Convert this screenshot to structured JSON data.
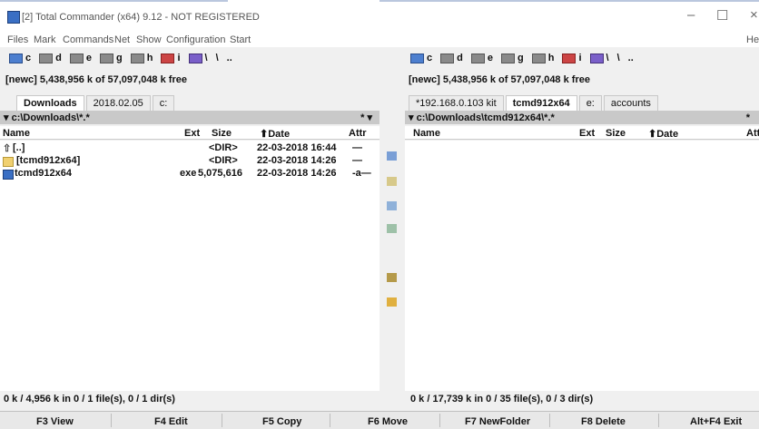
{
  "window": {
    "title": "[2] Total Commander (x64) 9.12 - NOT REGISTERED",
    "minimize": "–",
    "maximize": "☐",
    "close": "×"
  },
  "menu": [
    "Files",
    "Mark",
    "Commands",
    "Net",
    "Show",
    "Configuration",
    "Start"
  ],
  "menu_right": "He",
  "drives": [
    {
      "letter": "c",
      "selected": true
    },
    {
      "letter": "d",
      "selected": false
    },
    {
      "letter": "e",
      "selected": false
    },
    {
      "letter": "g",
      "selected": false
    },
    {
      "letter": "h",
      "selected": false
    },
    {
      "letter": "i",
      "selected": false
    },
    {
      "letter": "\\",
      "selected": false
    },
    {
      "letter": "\\",
      "selected": false
    },
    {
      "letter": "..",
      "selected": false
    }
  ],
  "left": {
    "free": "[newc]  5,438,956 k of 57,097,048 k free",
    "tabs": [
      {
        "label": "Downloads",
        "active": true
      },
      {
        "label": "2018.02.05",
        "active": false
      },
      {
        "label": "c:",
        "active": false
      }
    ],
    "path": "▾ c:\\Downloads\\*.*",
    "path_right": "* ▾",
    "headers": {
      "name": "Name",
      "ext": "Ext",
      "size": "Size",
      "date": "⬆Date",
      "attr": "Attr"
    },
    "rows": [
      {
        "name": "[..]",
        "ext": "",
        "size": "<DIR>",
        "date": "22-03-2018 16:44",
        "attr": "—",
        "icon": "up"
      },
      {
        "name": "[tcmd912x64]",
        "ext": "",
        "size": "<DIR>",
        "date": "22-03-2018 14:26",
        "attr": "—",
        "icon": "folder"
      },
      {
        "name": "tcmd912x64",
        "ext": "exe",
        "size": "5,075,616",
        "date": "22-03-2018 14:26",
        "attr": "-a—",
        "icon": "exe"
      }
    ],
    "status": "0 k / 4,956 k in 0 / 1 file(s), 0 / 1 dir(s)"
  },
  "right": {
    "free": "[newc]  5,438,956 k of 57,097,048 k free",
    "tabs": [
      {
        "label": "*192.168.0.103  kit",
        "active": false
      },
      {
        "label": "tcmd912x64",
        "active": true
      },
      {
        "label": "e:",
        "active": false
      },
      {
        "label": "accounts",
        "active": false
      }
    ],
    "path": "▾ c:\\Downloads\\tcmd912x64\\*.*",
    "path_right": "*",
    "headers": {
      "name": "Name",
      "ext": "Ext",
      "size": "Size",
      "date": "⬆Date",
      "attr": "Attr"
    },
    "status": "0 k / 17,739 k in 0 / 35 file(s), 0 / 3 dir(s)"
  },
  "fkeys": [
    {
      "label": "F3 View"
    },
    {
      "label": "F4 Edit"
    },
    {
      "label": "F5 Copy"
    },
    {
      "label": "F6 Move"
    },
    {
      "label": "F7 NewFolder"
    },
    {
      "label": "F8 Delete"
    },
    {
      "label": "Alt+F4 Exit"
    }
  ],
  "colors": {
    "accent": "#3a6fc4",
    "path_bar": "#c9c9c9"
  }
}
